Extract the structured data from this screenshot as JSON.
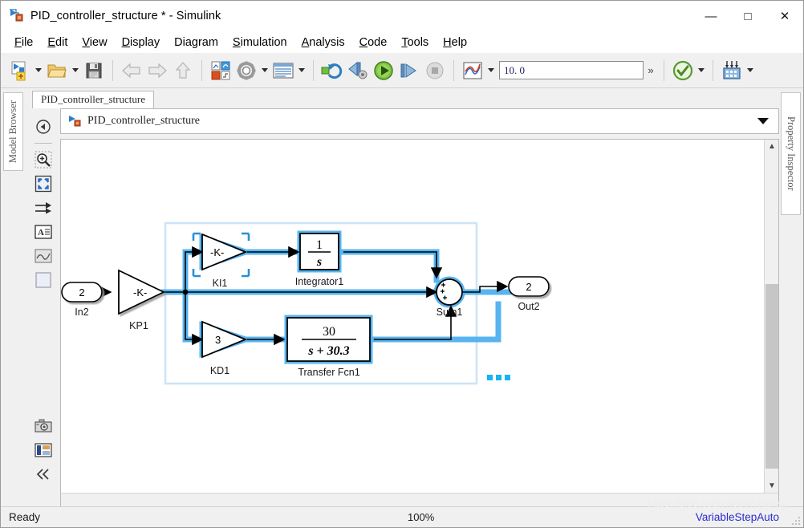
{
  "window": {
    "title": "PID_controller_structure * - Simulink",
    "icon": "simulink-model-icon",
    "controls": {
      "minimize": "—",
      "maximize": "□",
      "close": "✕"
    }
  },
  "menubar": {
    "items": [
      {
        "label": "File",
        "mnemonic": "F"
      },
      {
        "label": "Edit",
        "mnemonic": "E"
      },
      {
        "label": "View",
        "mnemonic": "V"
      },
      {
        "label": "Display",
        "mnemonic": "D"
      },
      {
        "label": "Diagram",
        "mnemonic": ""
      },
      {
        "label": "Simulation",
        "mnemonic": "S"
      },
      {
        "label": "Analysis",
        "mnemonic": "A"
      },
      {
        "label": "Code",
        "mnemonic": "C"
      },
      {
        "label": "Tools",
        "mnemonic": "T"
      },
      {
        "label": "Help",
        "mnemonic": "H"
      }
    ]
  },
  "toolbar": {
    "new_model_icon": "new-model-icon",
    "open_icon": "open-folder-icon",
    "save_icon": "save-icon",
    "back_icon": "back-arrow-icon",
    "forward_icon": "forward-arrow-icon",
    "up_icon": "up-arrow-icon",
    "library_icon": "library-browser-icon",
    "settings_icon": "model-settings-gear-icon",
    "config_icon": "model-configuration-icon",
    "update_icon": "update-model-icon",
    "fast_restart_icon": "fast-restart-icon",
    "run_icon": "run-simulation-icon",
    "step_forward_icon": "step-forward-icon",
    "stop_icon": "stop-simulation-icon",
    "scope_icon": "simulation-data-inspector-icon",
    "overflow_icon": "overflow-chevrons-icon",
    "check_icon": "model-advisor-check-icon",
    "deploy_icon": "build-deploy-icon",
    "sim_time": {
      "value": "10. 0",
      "placeholder": "10.0"
    }
  },
  "left_dock": {
    "tab_label": "Model Browser"
  },
  "right_dock": {
    "tab_label": "Property Inspector"
  },
  "editor": {
    "tab_label": "PID_controller_structure",
    "breadcrumb": {
      "icon": "simulink-model-icon",
      "text": "PID_controller_structure"
    },
    "side_tools": [
      {
        "name": "navigate-back-icon"
      },
      {
        "name": "zoom-in-icon"
      },
      {
        "name": "fit-to-view-icon"
      },
      {
        "name": "signal-arrow-icon"
      },
      {
        "name": "annotation-text-icon"
      },
      {
        "name": "scope-viewer-icon"
      },
      {
        "name": "area-rectangle-icon"
      },
      {
        "name": "snapshot-camera-icon"
      },
      {
        "name": "legend-icon"
      },
      {
        "name": "collapse-panel-icon"
      }
    ]
  },
  "diagram": {
    "subsystem_box_color": "#cfe4f7",
    "highlight_color": "#3fa9f5",
    "blocks": [
      {
        "name": "inport-in2",
        "label": "In2",
        "text": "2",
        "type": "inport"
      },
      {
        "name": "gain-kp1",
        "label": "KP1",
        "text": "-K-",
        "type": "gain"
      },
      {
        "name": "gain-ki1",
        "label": "KI1",
        "text": "-K-",
        "type": "gain",
        "selected": true
      },
      {
        "name": "gain-kd1",
        "label": "KD1",
        "text": "3",
        "type": "gain"
      },
      {
        "name": "integrator1",
        "label": "Integrator1",
        "numerator": "1",
        "denominator": "s",
        "type": "transfer"
      },
      {
        "name": "transfer-fcn1",
        "label": "Transfer Fcn1",
        "numerator": "30",
        "denominator": "s + 30.3",
        "type": "transfer"
      },
      {
        "name": "sum1",
        "label": "Sum1",
        "signs": "+++",
        "type": "sum"
      },
      {
        "name": "outport-out2",
        "label": "Out2",
        "text": "2",
        "type": "outport"
      }
    ],
    "ellipsis_indicator": "•••"
  },
  "statusbar": {
    "status": "Ready",
    "zoom": "100%",
    "solver": "VariableStepAuto",
    "watermark": "https://blog.csdn.net/Williamsjj"
  }
}
